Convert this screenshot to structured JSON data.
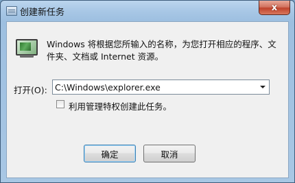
{
  "window": {
    "title": "创建新任务",
    "close_glyph": "x"
  },
  "icons": {
    "app": "window-icon",
    "run": "monitor-icon"
  },
  "description": "Windows 将根据您所输入的名称，为您打开相应的程序、文件夹、文档或 Internet 资源。",
  "open": {
    "label": "打开(O):",
    "value": "C:\\Windows\\explorer.exe"
  },
  "admin_checkbox": {
    "label": "利用管理特权创建此任务。",
    "checked": false
  },
  "buttons": {
    "ok": "确定",
    "cancel": "取消"
  },
  "colors": {
    "titlebar": "#a9c8e6",
    "close": "#c0432c",
    "client": "#f0f0f0"
  }
}
